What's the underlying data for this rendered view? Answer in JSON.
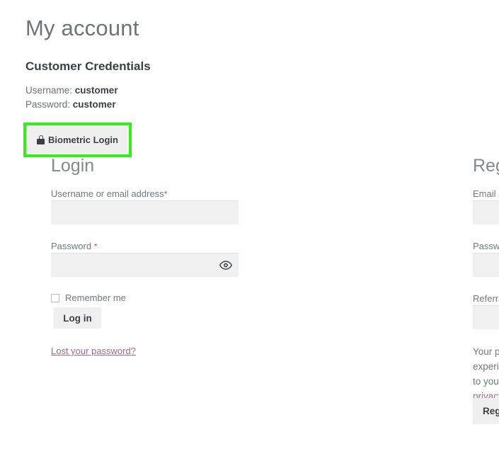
{
  "page": {
    "title": "My account"
  },
  "credentials": {
    "heading": "Customer Credentials",
    "username_label": "Username:",
    "username_value": "customer",
    "password_label": "Password:",
    "password_value": "customer"
  },
  "biometric": {
    "label": "Biometric Login",
    "icon": "lock-icon",
    "highlight_color": "#2cf312"
  },
  "login": {
    "heading": "Login",
    "username_label": "Username or email address",
    "username_required": "*",
    "username_value": "",
    "password_label": "Password",
    "password_required": "*",
    "password_value": "",
    "show_password_icon": "eye-icon",
    "remember_label": "Remember me",
    "remember_checked": false,
    "submit_label": "Log in",
    "lost_password_label": "Lost your password?"
  },
  "register": {
    "heading": "Register",
    "email_label": "Email address",
    "email_required": "*",
    "email_value": "",
    "password_label": "Password",
    "password_required": "*",
    "password_value": "",
    "show_password_icon": "eye-icon",
    "referral_label": "Referral Username",
    "referral_value": "",
    "privacy_text_before": "Your personal data will be used to support your experience throughout this website, to manage access to your account, and for other purposes described in our ",
    "privacy_link_label": "privacy policy",
    "privacy_text_after": ".",
    "submit_label": "Register"
  },
  "colors": {
    "required_asterisk": "#c9502a",
    "link": "#9b6b8d",
    "input_background": "#f0f0f0",
    "button_background": "#efefef",
    "annotation_green": "#2cf312"
  }
}
